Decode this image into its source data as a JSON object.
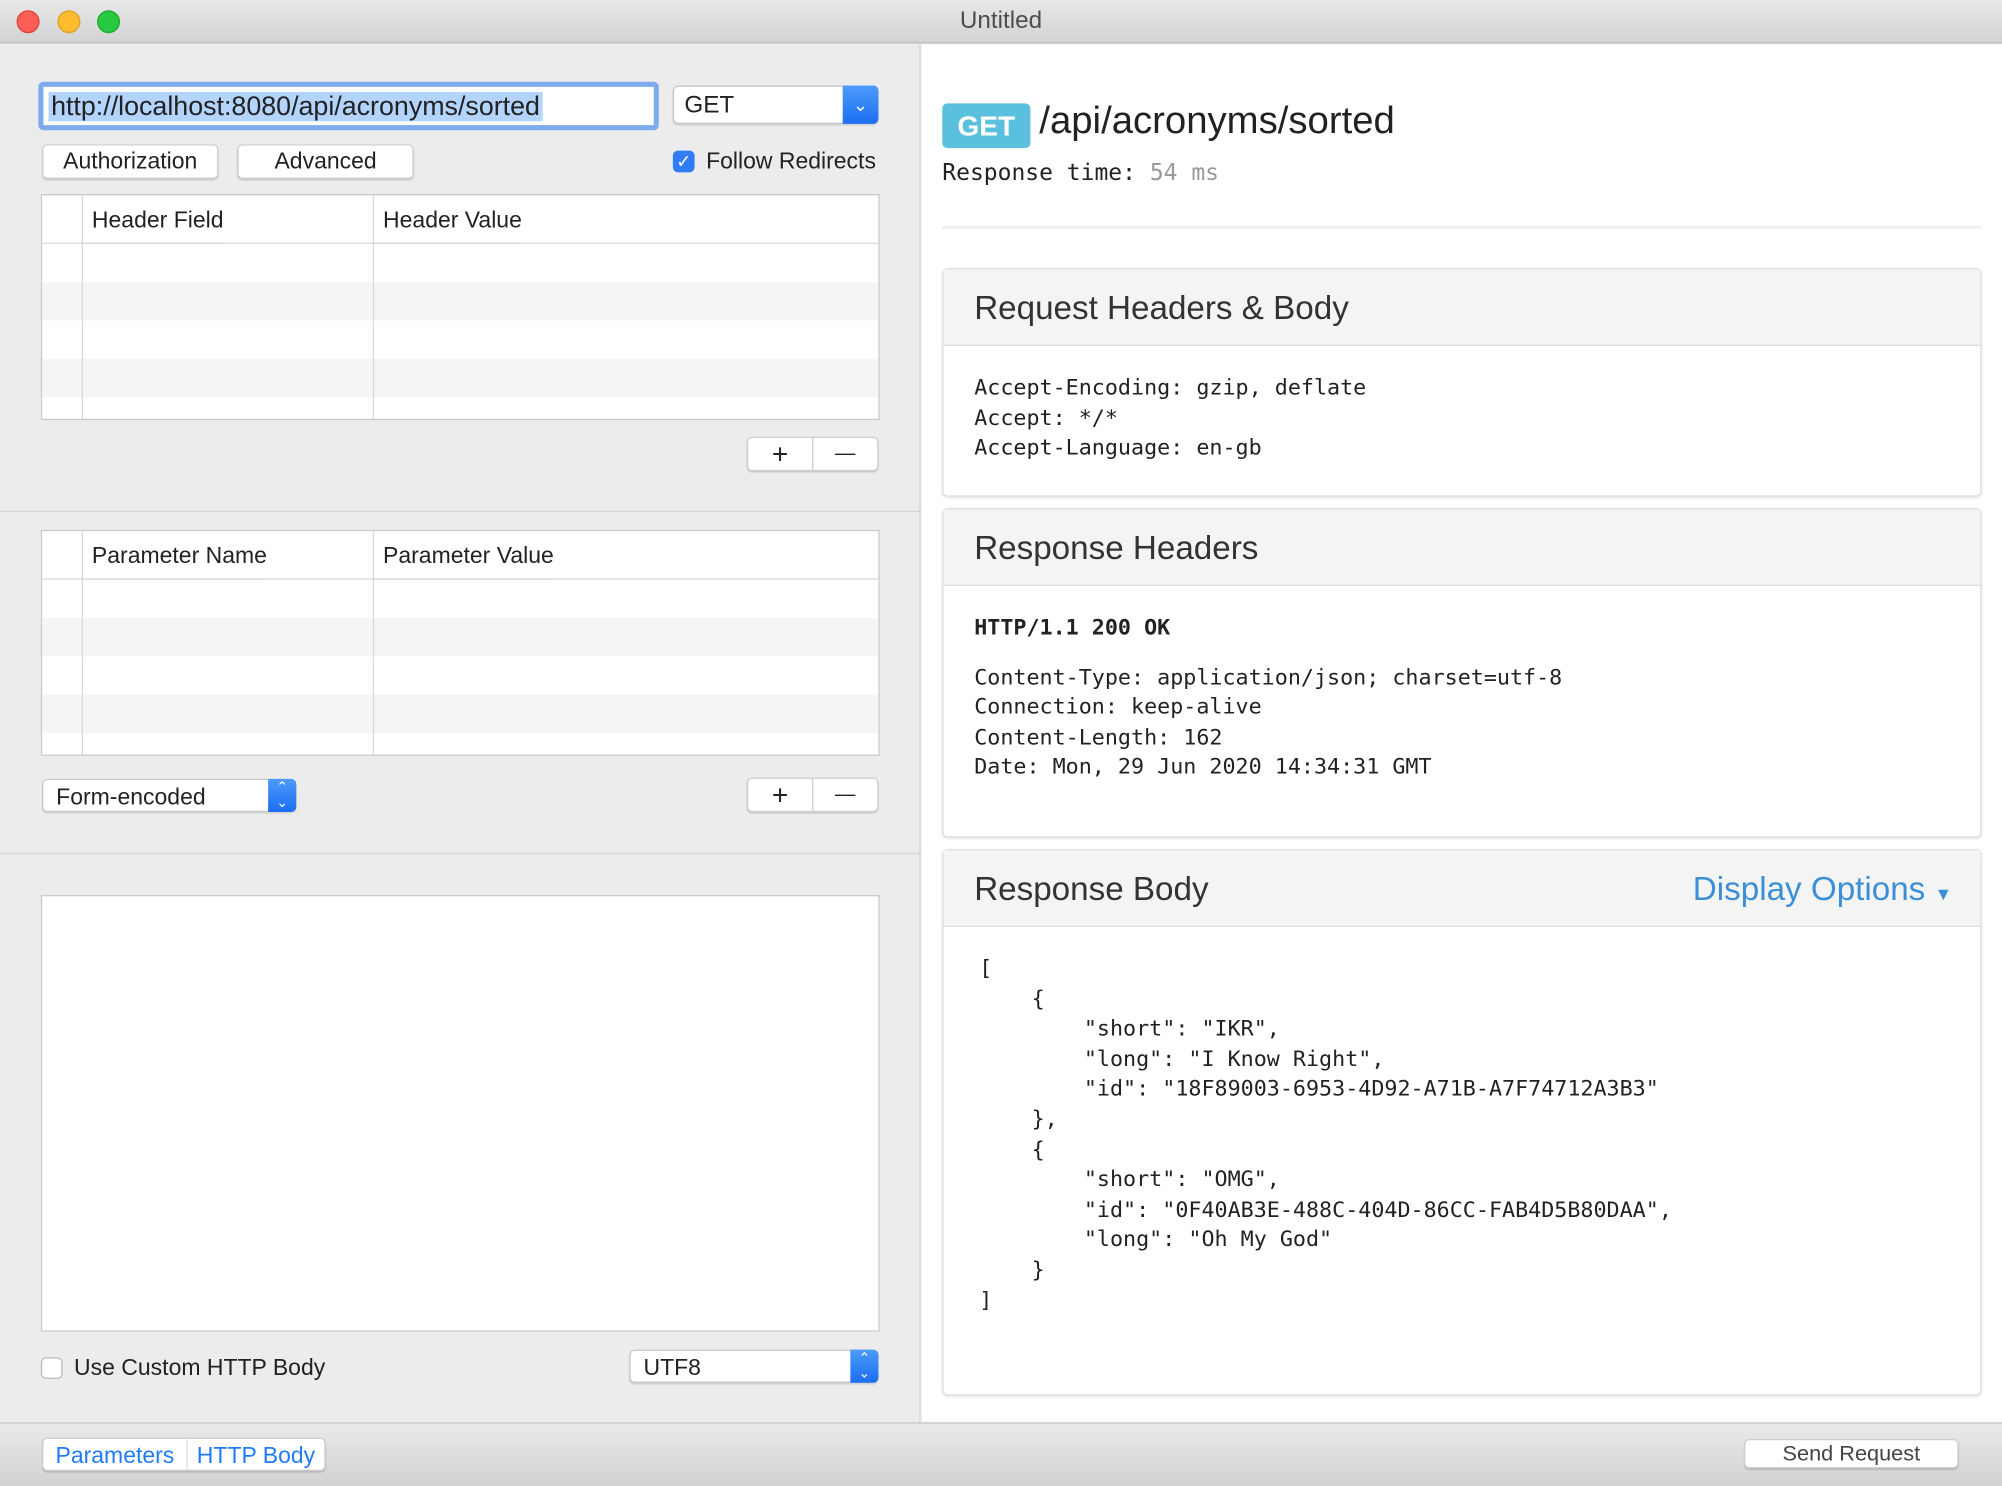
{
  "window": {
    "title": "Untitled"
  },
  "request": {
    "url": "http://localhost:8080/api/acronyms/sorted",
    "method": "GET",
    "authorization_label": "Authorization",
    "advanced_label": "Advanced",
    "follow_redirects_label": "Follow Redirects",
    "follow_redirects": true,
    "headers_table": {
      "columns": [
        "Header Field",
        "Header Value"
      ],
      "rows": []
    },
    "params_table": {
      "columns": [
        "Parameter Name",
        "Parameter Value"
      ],
      "rows": []
    },
    "add_label": "+",
    "remove_label": "—",
    "encoding": "Form-encoded",
    "body": "",
    "use_custom_body_label": "Use Custom HTTP Body",
    "use_custom_body": false,
    "charset": "UTF8"
  },
  "bottom_bar": {
    "tabs": [
      "Parameters",
      "HTTP Body"
    ],
    "send_label": "Send Request"
  },
  "response": {
    "method_badge": "GET",
    "path": "/api/acronyms/sorted",
    "time_label": "Response time:",
    "time_value": "54 ms",
    "request_section": {
      "title": "Request Headers & Body",
      "lines": "Accept-Encoding: gzip, deflate\nAccept: */*\nAccept-Language: en-gb"
    },
    "headers_section": {
      "title": "Response Headers",
      "status": "HTTP/1.1 200 OK",
      "lines": "Content-Type: application/json; charset=utf-8\nConnection: keep-alive\nContent-Length: 162\nDate: Mon, 29 Jun 2020 14:34:31 GMT"
    },
    "body_section": {
      "title": "Response Body",
      "display_options": "Display Options",
      "body": "[\n    {\n        \"short\": \"IKR\",\n        \"long\": \"I Know Right\",\n        \"id\": \"18F89003-6953-4D92-A71B-A7F74712A3B3\"\n    },\n    {\n        \"short\": \"OMG\",\n        \"id\": \"0F40AB3E-488C-404D-86CC-FAB4D5B80DAA\",\n        \"long\": \"Oh My God\"\n    }\n]"
    }
  },
  "colors": {
    "accent": "#1f6ff2",
    "badge": "#5bc0de",
    "link": "#3a8fd6"
  }
}
